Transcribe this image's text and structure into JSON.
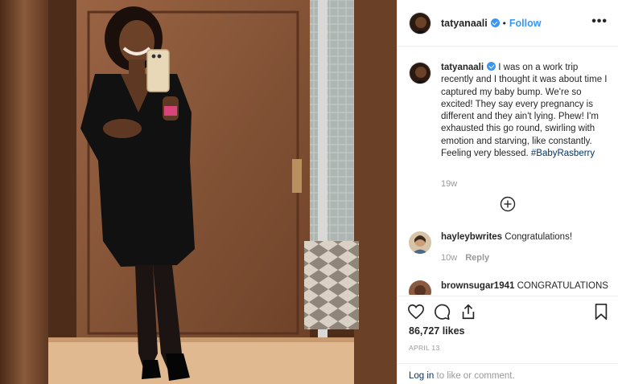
{
  "post": {
    "username": "tatyanaali",
    "follow_label": "Follow",
    "separator": "•",
    "more_label": "•••"
  },
  "caption": {
    "username": "tatyanaali",
    "text": "I was on a work trip recently and I thought it was about time I captured my baby bump. We're so excited! They say every pregnancy is different and they ain't lying. Phew! I'm exhausted this go round, swirling with emotion and starving, like constantly. Feeling very blessed.",
    "hashtag": "#BabyRasberry",
    "time": "19w"
  },
  "comments": [
    {
      "username": "hayleybwrites",
      "text": "Congratulations!",
      "time": "10w",
      "reply_label": "Reply"
    },
    {
      "username": "brownsugar1941",
      "text": "CONGRATULATIONS"
    }
  ],
  "likes": "86,727 likes",
  "date": "APRIL 13",
  "login": {
    "link": "Log in",
    "rest": "to like or comment."
  },
  "icons": [
    "heart-icon",
    "comment-icon",
    "share-icon",
    "bookmark-icon",
    "add-comment-icon",
    "more-icon",
    "verified-icon"
  ],
  "colors": {
    "link": "#3897f0",
    "hashtag": "#003569",
    "muted": "#999999",
    "text": "#262626"
  }
}
